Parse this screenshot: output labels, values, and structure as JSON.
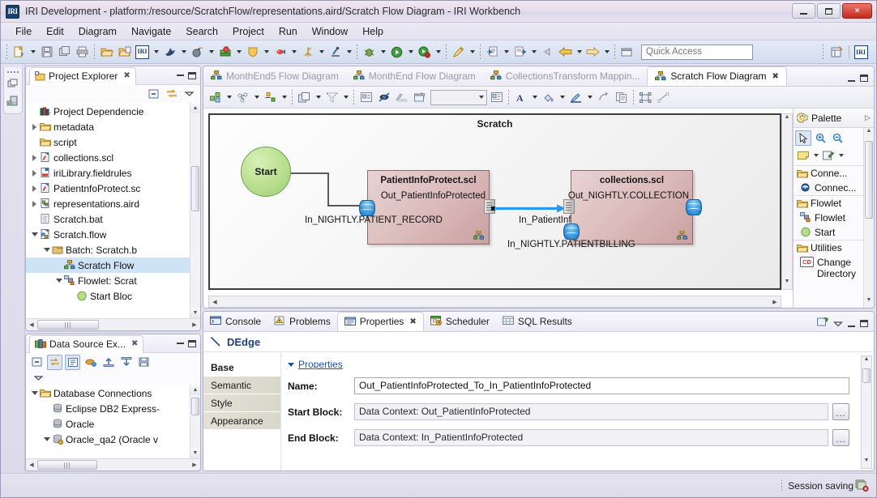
{
  "window": {
    "title": "IRI Development - platform:/resource/ScratchFlow/representations.aird/Scratch Flow Diagram - IRI Workbench",
    "logo": "IRI",
    "minimize": "minimize-button",
    "maximize": "restore-button",
    "close": "×"
  },
  "menubar": {
    "items": [
      "File",
      "Edit",
      "Diagram",
      "Navigate",
      "Search",
      "Project",
      "Run",
      "Window",
      "Help"
    ]
  },
  "toolbar": {
    "quick_access_placeholder": "Quick Access",
    "perspective_label": "IRI",
    "buttons": [
      "new-wizard",
      "save",
      "save-all",
      "print",
      "open-folder",
      "open-project",
      "iri-tools",
      "dolphin-tools",
      "bomb-tools",
      "book-tools",
      "shield-tools",
      "fish-tools",
      "trace-tools",
      "scope-tools",
      "debug",
      "run",
      "run-profile",
      "pen-tools",
      "import",
      "export",
      "back",
      "previous",
      "forward",
      "new-editor"
    ]
  },
  "project_explorer": {
    "tab_label": "Project Explorer",
    "toolbar": [
      "collapse-all-icon",
      "link-with-editor-icon",
      "view-menu-icon"
    ],
    "items": [
      {
        "label": "Project Dependencie",
        "icon": "library-icon",
        "indent": 1,
        "twisty": "none"
      },
      {
        "label": "metadata",
        "icon": "folder-icon",
        "indent": 1,
        "twisty": "closed"
      },
      {
        "label": "script",
        "icon": "folder-icon",
        "indent": 1,
        "twisty": "none"
      },
      {
        "label": "collections.scl",
        "icon": "scl-file-icon",
        "indent": 1,
        "twisty": "closed"
      },
      {
        "label": "iriLibrary.fieldrules",
        "icon": "fieldrules-file-icon",
        "indent": 1,
        "twisty": "closed"
      },
      {
        "label": "PatientnfoProtect.sc",
        "icon": "scl-file-icon",
        "indent": 1,
        "twisty": "closed"
      },
      {
        "label": "representations.aird",
        "icon": "aird-file-icon",
        "indent": 1,
        "twisty": "closed"
      },
      {
        "label": "Scratch.bat",
        "icon": "bat-file-icon",
        "indent": 1,
        "twisty": "none"
      },
      {
        "label": "Scratch.flow",
        "icon": "flow-file-icon",
        "indent": 1,
        "twisty": "open"
      },
      {
        "label": "Batch: Scratch.b",
        "icon": "batch-icon",
        "indent": 2,
        "twisty": "open"
      },
      {
        "label": "Scratch Flow",
        "icon": "flow-diagram-icon",
        "indent": 3,
        "twisty": "none",
        "selected": true
      },
      {
        "label": "Flowlet: Scrat",
        "icon": "flowlet-icon",
        "indent": 3,
        "twisty": "open"
      },
      {
        "label": "Start Bloc",
        "icon": "start-circle-icon",
        "indent": 4,
        "twisty": "none"
      }
    ]
  },
  "data_source_explorer": {
    "tab_label": "Data Source Ex...",
    "toolbar": [
      "collapse-all-icon",
      "link-icon",
      "filter-icon",
      "new-connection-icon",
      "import-icon",
      "export-icon",
      "save-icon",
      "view-menu-icon"
    ],
    "items": [
      {
        "label": "Database Connections",
        "icon": "folder-icon",
        "indent": 1,
        "twisty": "open"
      },
      {
        "label": "Eclipse DB2 Express-",
        "icon": "database-icon",
        "indent": 2,
        "twisty": "none"
      },
      {
        "label": "Oracle",
        "icon": "database-icon",
        "indent": 2,
        "twisty": "none"
      },
      {
        "label": "Oracle_qa2 (Oracle v",
        "icon": "database-connected-icon",
        "indent": 2,
        "twisty": "open"
      }
    ]
  },
  "editor": {
    "tabs": [
      {
        "label": "MonthEnd5 Flow Diagram",
        "active": false
      },
      {
        "label": "MonthEnd Flow Diagram",
        "active": false
      },
      {
        "label": "CollectionsTransform Mappin...",
        "active": false
      },
      {
        "label": "Scratch Flow Diagram",
        "active": true
      }
    ],
    "toolbar": {
      "zoom_value": "",
      "buttons": [
        "arrange-all",
        "select-elements",
        "align",
        "order",
        "filter",
        "show-hide-compartment",
        "pin",
        "unpin",
        "hide-label",
        "properties-view",
        "font",
        "fill-color",
        "line-color",
        "route",
        "copy-appearance",
        "select-all-shapes",
        "select-all-connections"
      ]
    }
  },
  "diagram": {
    "title": "Scratch",
    "start_node": "Start",
    "blocks": [
      {
        "name": "PatientInfoProtect.scl",
        "output": "Out_PatientInfoProtected",
        "input": "In_NIGHTLY.PATIENT_RECORD"
      },
      {
        "name": "collections.scl",
        "output": "Out_NIGHTLY.COLLECTION",
        "input_top": "In_PatientInfoProtected",
        "input_bottom": "In_NIGHTLY.PATIENTBILLING"
      }
    ]
  },
  "palette": {
    "title": "Palette",
    "tools": [
      "select-tool",
      "zoom-in-tool",
      "zoom-out-tool",
      "note-tool",
      "note-attachment-tool"
    ],
    "groups": [
      {
        "label": "Conne...",
        "items": [
          {
            "label": "Connec...",
            "icon": "connection-icon"
          }
        ]
      },
      {
        "label": "Flowlet",
        "items": [
          {
            "label": "Flowlet",
            "icon": "flowlet-icon"
          },
          {
            "label": "Start",
            "icon": "start-circle-icon"
          }
        ]
      },
      {
        "label": "Utilities",
        "items": [
          {
            "label": "Change Directory",
            "icon": "cd-icon"
          }
        ]
      }
    ]
  },
  "bottom_panel": {
    "tabs": [
      {
        "label": "Console",
        "icon": "console-icon",
        "active": false
      },
      {
        "label": "Problems",
        "icon": "problems-icon",
        "active": false
      },
      {
        "label": "Properties",
        "icon": "properties-icon",
        "active": true
      },
      {
        "label": "Scheduler",
        "icon": "scheduler-icon",
        "active": false
      },
      {
        "label": "SQL Results",
        "icon": "sql-results-icon",
        "active": false
      }
    ],
    "selection_title": "DEdge",
    "side_tabs": [
      {
        "label": "Base",
        "selected": true
      },
      {
        "label": "Semantic",
        "selected": false
      },
      {
        "label": "Style",
        "selected": false
      },
      {
        "label": "Appearance",
        "selected": false
      }
    ],
    "section_label": "Properties",
    "fields": [
      {
        "label": "Name:",
        "value": "Out_PatientInfoProtected_To_In_PatientInfoProtected",
        "browse": false
      },
      {
        "label": "Start Block:",
        "value": "Data Context: Out_PatientInfoProtected",
        "browse": true,
        "browse_label": "..."
      },
      {
        "label": "End Block:",
        "value": "Data Context: In_PatientInfoProtected",
        "browse": true,
        "browse_label": "..."
      }
    ]
  },
  "statusbar": {
    "message": "Session saving",
    "right_icon": "save-conflict-icon"
  },
  "colors": {
    "title_bar": "#e6dfee",
    "accent_blue": "#2f97e8",
    "block_fill": "#dcbcbc",
    "start_fill": "#b6dd8c",
    "selection": "#cfe3f7",
    "properties_heading": "#1f3f7a"
  }
}
